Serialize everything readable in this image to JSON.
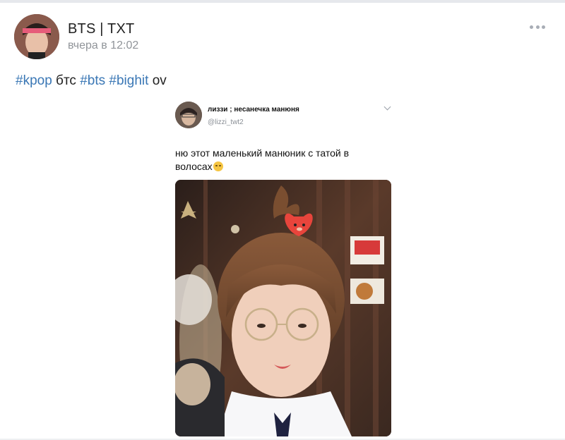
{
  "post": {
    "author": "BTS | TXT",
    "time": "вчера в 12:02",
    "text_parts": [
      {
        "text": "#kpop",
        "type": "tag"
      },
      {
        "text": " бтс ",
        "type": "plain"
      },
      {
        "text": "#bts",
        "type": "tag"
      },
      {
        "text": " ",
        "type": "plain"
      },
      {
        "text": "#bighit",
        "type": "tag"
      },
      {
        "text": " ov",
        "type": "plain"
      }
    ],
    "menu_icon": "more-dots-icon"
  },
  "tweet": {
    "name": "лиззи ; несанечка манюня",
    "handle": "@lizzi_twt2",
    "text": "ню этот маленький манюник с татой в волосах",
    "emoji": "relieved-face-emoji"
  },
  "colors": {
    "tag": "#3a77b5",
    "text": "#222222",
    "muted": "#909499"
  }
}
